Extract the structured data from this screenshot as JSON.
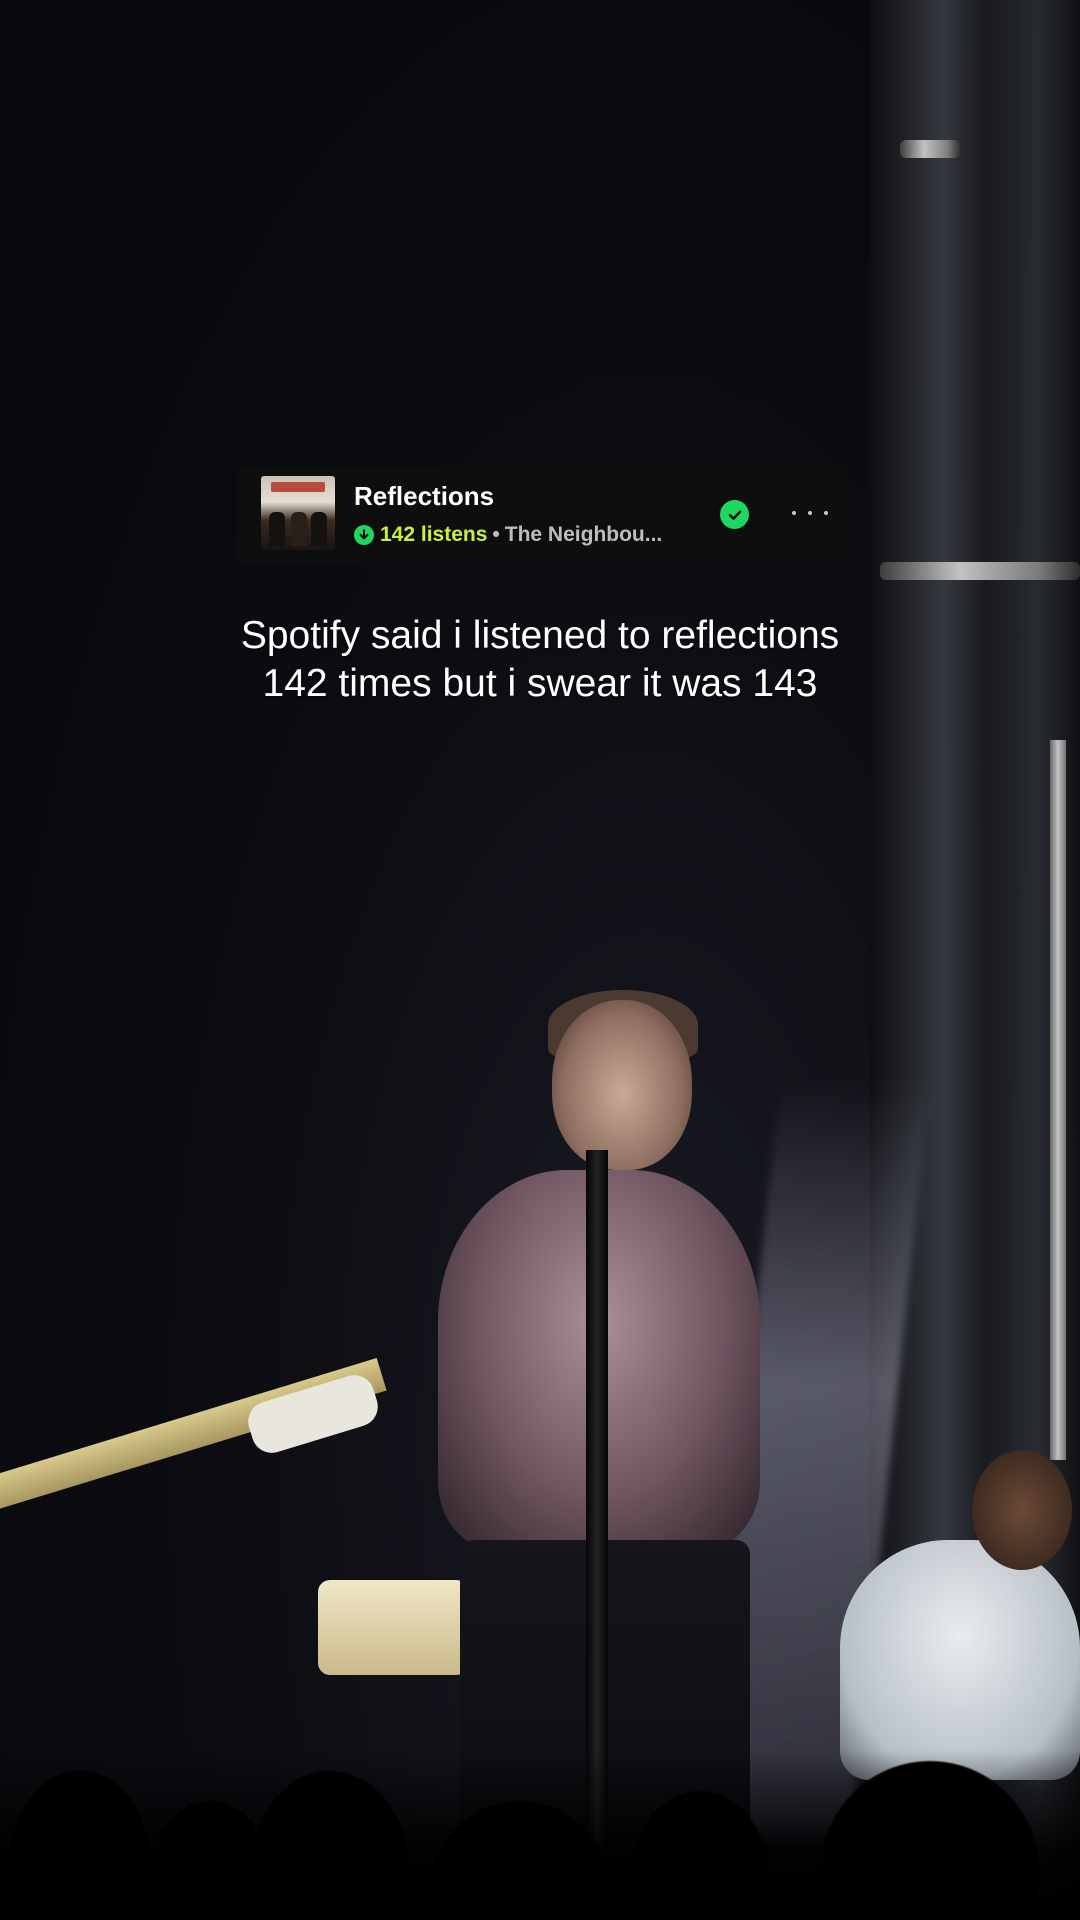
{
  "track": {
    "title": "Reflections",
    "listens": "142 listens",
    "separator": "•",
    "artist": "The Neighbou..."
  },
  "caption": "Spotify said i listened to reflections 142 times but i swear it was 143",
  "icons": {
    "download": "download-arrow-icon",
    "added": "check-circle-icon",
    "more": "more-options-icon"
  },
  "colors": {
    "spotify_green": "#1ed760",
    "listens_accent": "#c7f23a",
    "card_background": "#0e0e0f"
  }
}
